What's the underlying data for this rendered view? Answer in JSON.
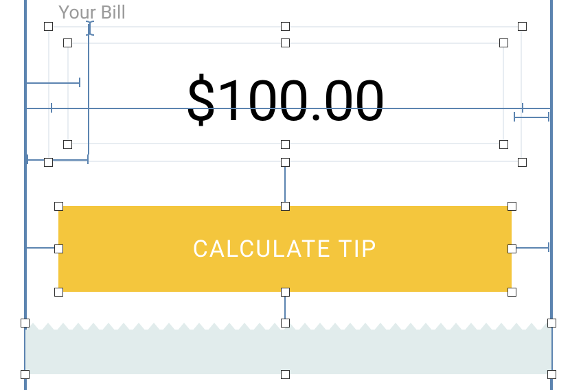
{
  "bill": {
    "label": "Your Bill",
    "amount": "$100.00"
  },
  "button": {
    "calculate": "CALCULATE TIP"
  },
  "colors": {
    "accent": "#f4c63d",
    "guide": "#5c84b0",
    "receipt": "#e1ecec",
    "label": "#9b9b9b"
  }
}
